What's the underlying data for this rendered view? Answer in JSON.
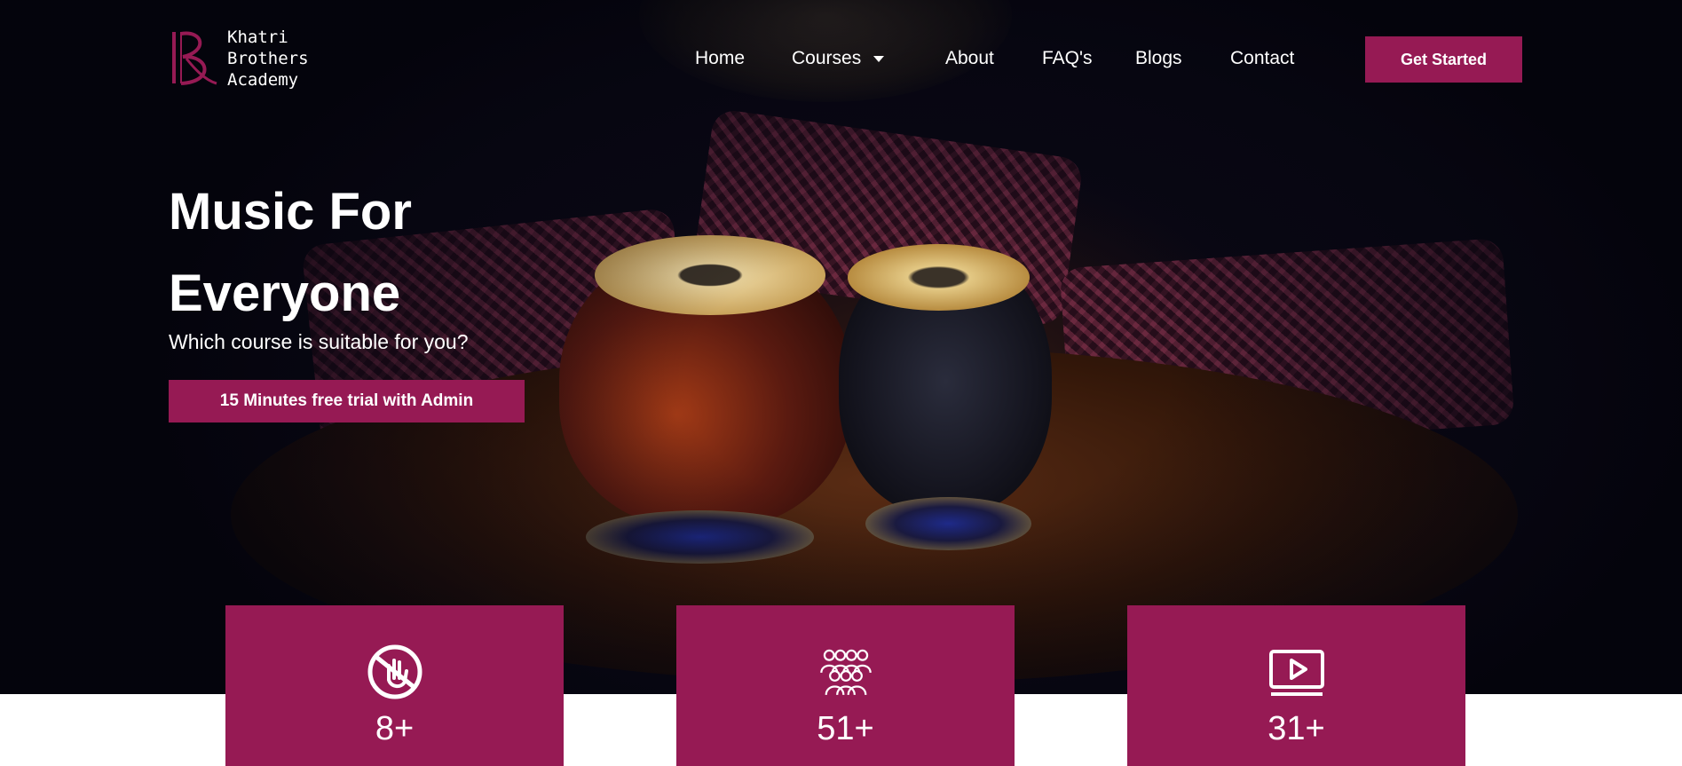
{
  "brand": {
    "name_lines": [
      "Khatri",
      "Brothers",
      "Academy"
    ],
    "accent_color": "#961a54"
  },
  "nav": {
    "items": [
      {
        "label": "Home"
      },
      {
        "label": "Courses",
        "has_dropdown": true
      },
      {
        "label": "About"
      },
      {
        "label": "FAQ's"
      },
      {
        "label": "Blogs"
      },
      {
        "label": "Contact"
      }
    ],
    "cta_label": "Get Started"
  },
  "hero": {
    "title_line1": "Music For",
    "title_line2": "Everyone",
    "subtitle": "Which course is suitable for you?",
    "trial_button": "15 Minutes free trial with Admin"
  },
  "stats": [
    {
      "icon": "no-hand-icon",
      "value": "8+"
    },
    {
      "icon": "group-people-icon",
      "value": "51+"
    },
    {
      "icon": "video-play-icon",
      "value": "31+"
    }
  ]
}
